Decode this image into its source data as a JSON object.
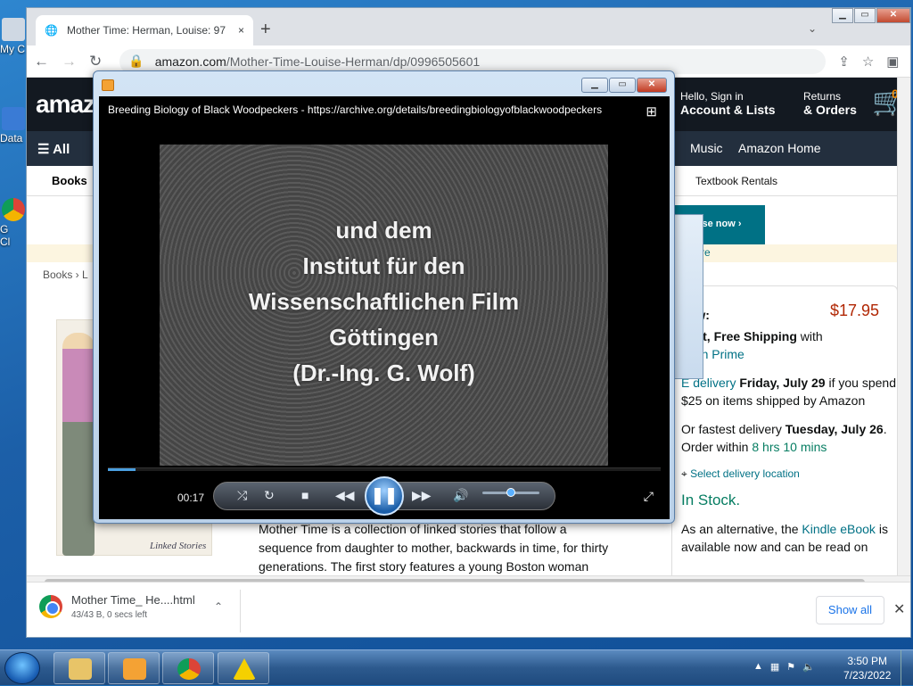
{
  "desktop": {
    "icons": [
      {
        "label": "My C"
      },
      {
        "label": "Data"
      },
      {
        "label": "G"
      },
      {
        "label": "Cl"
      }
    ]
  },
  "browser": {
    "tab_title": "Mother Time: Herman, Louise: 97",
    "tab_close": "×",
    "new_tab": "+",
    "url_domain": "amazon.com",
    "url_path": "/Mother-Time-Louise-Herman/dp/0996505601",
    "window_buttons": {
      "minimize": "▁",
      "maximize": "▭",
      "close": "✕"
    }
  },
  "amazon": {
    "logo": "amaz",
    "account_greeting": "Hello, Sign in",
    "account_label": "Account & Lists",
    "returns_label": "Returns",
    "orders_label": "& Orders",
    "cart_count": "0",
    "all_label": "All",
    "nav_music": "Music",
    "nav_home": "Amazon Home",
    "books_label": "Books",
    "textbook_rentals": "Textbook Rentals",
    "browse_now": "Browse now ›",
    "yellow_strip_text": "re",
    "breadcrumb": "Books ›  L",
    "cover_label": "Linked Stories",
    "description_lines": [
      "Mother Time is a collection of linked stories that follow a",
      "sequence from daughter to mother, backwards in time, for thirty",
      "generations. The first story features a young Boston woman"
    ],
    "buybox": {
      "buy_new": "new:",
      "price": "$17.95",
      "shipping_bold": "Fast, Free Shipping",
      "shipping_with": "with",
      "prime": "azon Prime",
      "delivery_link": "E delivery",
      "delivery_date": "Friday, July 29",
      "delivery_cond": "if you spend $25 on items shipped by Amazon",
      "fastest_prefix": "Or fastest delivery",
      "fastest_date": "Tuesday, July 26",
      "order_within": "Order within",
      "countdown": "8 hrs 10 mins",
      "select_location": "Select delivery location",
      "in_stock": "In Stock.",
      "alt_prefix": "As an alternative, the",
      "kindle": "Kindle eBook",
      "alt_suffix": "is available now and can be read on"
    }
  },
  "download_bar": {
    "file_name": "Mother Time_ He....html",
    "file_status": "43/43 B, 0 secs left",
    "show_all": "Show all",
    "close": "✕"
  },
  "player": {
    "caption": "Breeding Biology of Black Woodpeckers - https://archive.org/details/breedingbiologyofblackwoodpeckers",
    "video_lines": [
      "und dem",
      "Institut für den",
      "Wissenschaftlichen Film",
      "Göttingen",
      "(Dr.-Ing. G. Wolf)"
    ],
    "time": "00:17",
    "progress": 0.05,
    "volume": 0.5,
    "buttons": {
      "minimize": "▁",
      "maximize": "▭",
      "close": "✕"
    }
  },
  "taskbar": {
    "time": "3:50 PM",
    "date": "7/23/2022"
  }
}
